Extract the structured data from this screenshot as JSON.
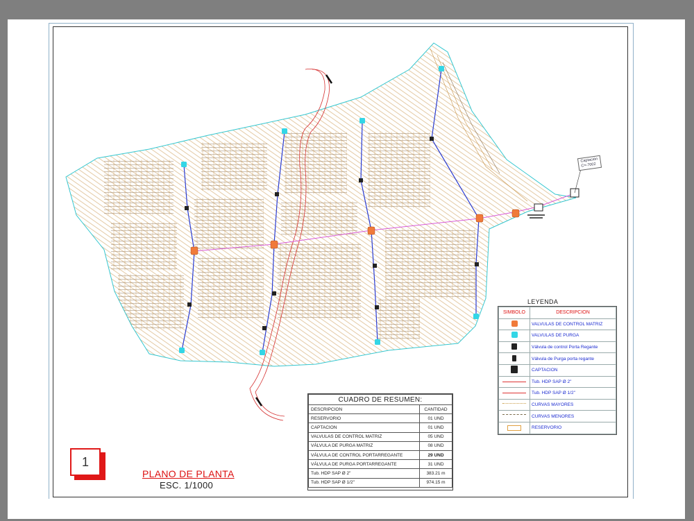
{
  "legend": {
    "title": "LEYENDA",
    "col_symbol": "SIMBOLO",
    "col_description": "DESCRIPCION",
    "items": [
      {
        "label": "VALVULAS DE CONTROL MATRIZ",
        "symbol": "orange-box",
        "color": "#f07a3a"
      },
      {
        "label": "VALVULAS DE PURGA",
        "symbol": "cyan-box",
        "color": "#33d6e6"
      },
      {
        "label": "Válvula de control Porta Regante",
        "symbol": "valve-icon",
        "color": "#222222"
      },
      {
        "label": "Válvula de Purga porta regante",
        "symbol": "purge-valve-icon",
        "color": "#222222"
      },
      {
        "label": "CAPTACION",
        "symbol": "intake-icon",
        "color": "#222222"
      },
      {
        "label": "Tub. HDP SAP Ø 2\"",
        "symbol": "red-line",
        "color": "#d33333"
      },
      {
        "label": "Tub. HDP SAP Ø 1/2\"",
        "symbol": "red-line",
        "color": "#d33333"
      },
      {
        "label": "CURVAS MAYORES",
        "symbol": "wave-line",
        "color": "#c89a45"
      },
      {
        "label": "CURVAS MENORES",
        "symbol": "wave-line-dark",
        "color": "#7a6a4a"
      },
      {
        "label": "RESERVORIO",
        "symbol": "reservoir-box",
        "color": "#e0a040"
      }
    ]
  },
  "summary": {
    "title": "CUADRO DE RESUMEN:",
    "col_description": "DESCRIPCION",
    "col_quantity": "CANTIDAD",
    "rows": [
      {
        "desc": "RESERVORIO",
        "qty": "01 UND",
        "bold": false
      },
      {
        "desc": "CAPTACION",
        "qty": "01 UND",
        "bold": false
      },
      {
        "desc": "VALVULAS DE CONTROL MATRIZ",
        "qty": "05 UND",
        "bold": false
      },
      {
        "desc": "VÁLVULA DE PURGA MATRIZ",
        "qty": "08 UND",
        "bold": false
      },
      {
        "desc": "VÁLVULA DE CONTROL PORTARREGANTE",
        "qty": "29 UND",
        "bold": true
      },
      {
        "desc": "VÁLVULA DE PURGA PORTARREGANTE",
        "qty": "31 UND",
        "bold": false
      },
      {
        "desc": "Tub. HDP SAP Ø 2\"",
        "qty": "383.21 m",
        "bold": false
      },
      {
        "desc": "Tub. HDP SAP Ø 1/2\"",
        "qty": "974.15 m",
        "bold": false
      }
    ]
  },
  "sheet": {
    "number": "1",
    "title": "PLANO DE PLANTA",
    "scale": "ESC. 1/1000"
  },
  "capture_label": "Captación\nC=-7002",
  "colors": {
    "contour_major": "#c8944a",
    "contour_minor": "#8a7050",
    "boundary": "#35c7d0",
    "main_pipe": "#d85bd8",
    "lateral_pipe": "#2a3bd0",
    "river": "#d53030",
    "control_valve": "#f07a3a",
    "purge_valve": "#33d6e6"
  }
}
